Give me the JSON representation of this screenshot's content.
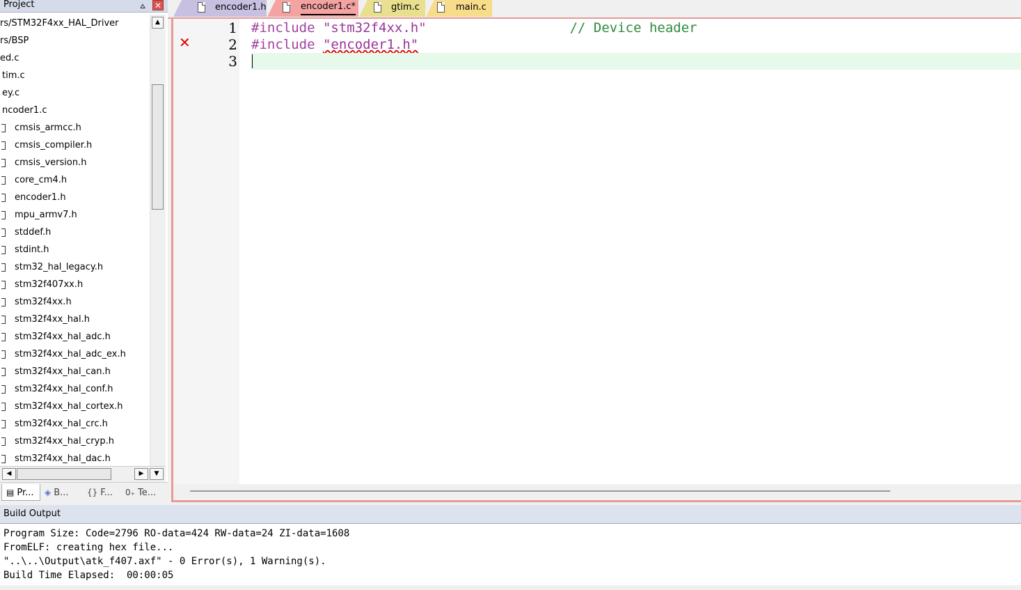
{
  "project_panel": {
    "title": "Project",
    "pin_glyph": "⩟",
    "close_glyph": "✕",
    "tree_items": [
      {
        "label": "rs/STM32F4xx_HAL_Driver",
        "icon": "none"
      },
      {
        "label": "rs/BSP",
        "icon": "none"
      },
      {
        "label": "ed.c",
        "icon": "none"
      },
      {
        "label": "tim.c",
        "icon": "none"
      },
      {
        "label": "ey.c",
        "icon": "none"
      },
      {
        "label": "ncoder1.c",
        "icon": "none"
      },
      {
        "label": "cmsis_armcc.h",
        "icon": "file"
      },
      {
        "label": "cmsis_compiler.h",
        "icon": "file"
      },
      {
        "label": "cmsis_version.h",
        "icon": "file"
      },
      {
        "label": "core_cm4.h",
        "icon": "file"
      },
      {
        "label": "encoder1.h",
        "icon": "file"
      },
      {
        "label": "mpu_armv7.h",
        "icon": "file"
      },
      {
        "label": "stddef.h",
        "icon": "file"
      },
      {
        "label": "stdint.h",
        "icon": "file"
      },
      {
        "label": "stm32_hal_legacy.h",
        "icon": "file"
      },
      {
        "label": "stm32f407xx.h",
        "icon": "file"
      },
      {
        "label": "stm32f4xx.h",
        "icon": "file"
      },
      {
        "label": "stm32f4xx_hal.h",
        "icon": "file"
      },
      {
        "label": "stm32f4xx_hal_adc.h",
        "icon": "file"
      },
      {
        "label": "stm32f4xx_hal_adc_ex.h",
        "icon": "file"
      },
      {
        "label": "stm32f4xx_hal_can.h",
        "icon": "file"
      },
      {
        "label": "stm32f4xx_hal_conf.h",
        "icon": "file"
      },
      {
        "label": "stm32f4xx_hal_cortex.h",
        "icon": "file"
      },
      {
        "label": "stm32f4xx_hal_crc.h",
        "icon": "file"
      },
      {
        "label": "stm32f4xx_hal_cryp.h",
        "icon": "file"
      },
      {
        "label": "stm32f4xx_hal_dac.h",
        "icon": "file"
      }
    ],
    "bottom_tabs": [
      {
        "label": "Pr...",
        "icon": "project-tab-icon"
      },
      {
        "label": "B...",
        "icon": "books-tab-icon"
      },
      {
        "label": "F...",
        "icon": "functions-tab-icon"
      },
      {
        "label": "Te...",
        "icon": "templates-tab-icon"
      }
    ]
  },
  "editor": {
    "tabs": [
      {
        "label": "encoder1.h",
        "active": false,
        "color": "#c8c0e0"
      },
      {
        "label": "encoder1.c*",
        "active": true,
        "color": "#f4a3a3"
      },
      {
        "label": "gtim.c",
        "active": false,
        "color": "#e8e08e"
      },
      {
        "label": "main.c",
        "active": false,
        "color": "#f7dc8a"
      }
    ],
    "line_numbers": [
      "1",
      "2",
      "3"
    ],
    "lines": [
      {
        "directive": "#include",
        "string": "\"stm32f4xx.h\"",
        "comment": "// Device header"
      },
      {
        "directive": "#include",
        "string": "\"encoder1.h\"",
        "comment": ""
      },
      {
        "directive": "",
        "string": "",
        "comment": ""
      }
    ],
    "error_line": 2,
    "current_line": 3,
    "colors": {
      "directive": "#a040a0",
      "string": "#993399",
      "comment": "#2e8b3a",
      "error": "#e00000",
      "current_line_bg": "#e6f9ea"
    }
  },
  "build_output": {
    "title": "Build Output",
    "lines": [
      "Program Size: Code=2796 RO-data=424 RW-data=24 ZI-data=1608",
      "FromELF: creating hex file...",
      "\"..\\..\\Output\\atk_f407.axf\" - 0 Error(s), 1 Warning(s).",
      "Build Time Elapsed:  00:00:05"
    ]
  }
}
